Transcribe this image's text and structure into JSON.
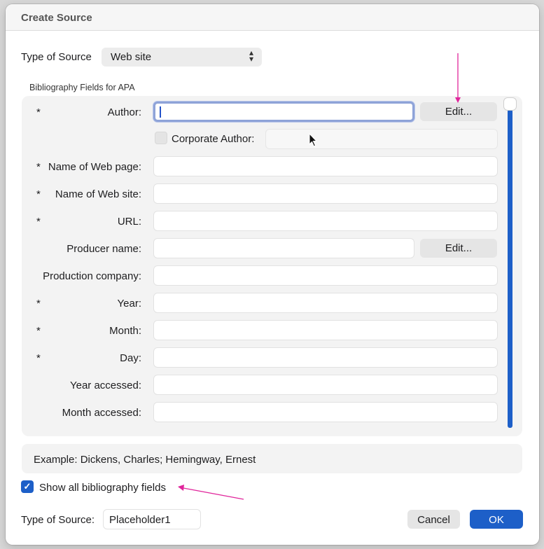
{
  "dialog": {
    "title": "Create Source"
  },
  "type_of_source": {
    "label": "Type of Source",
    "selected": "Web site"
  },
  "section_label": "Bibliography Fields for APA",
  "required_marker": "*",
  "fields": {
    "author": {
      "label": "Author:",
      "value": "",
      "required": true,
      "edit_label": "Edit..."
    },
    "corporate_author": {
      "label": "Corporate Author:",
      "checked": false,
      "value": ""
    },
    "name_of_web_page": {
      "label": "Name of Web page:",
      "value": "",
      "required": true
    },
    "name_of_web_site": {
      "label": "Name of Web site:",
      "value": "",
      "required": true
    },
    "url": {
      "label": "URL:",
      "value": "",
      "required": true
    },
    "producer_name": {
      "label": "Producer name:",
      "value": "",
      "required": false,
      "edit_label": "Edit..."
    },
    "production_company": {
      "label": "Production company:",
      "value": "",
      "required": false
    },
    "year": {
      "label": "Year:",
      "value": "",
      "required": true
    },
    "month": {
      "label": "Month:",
      "value": "",
      "required": true
    },
    "day": {
      "label": "Day:",
      "value": "",
      "required": true
    },
    "year_accessed": {
      "label": "Year accessed:",
      "value": "",
      "required": false
    },
    "month_accessed": {
      "label": "Month accessed:",
      "value": "",
      "required": false
    }
  },
  "example": "Example: Dickens, Charles; Hemingway, Ernest",
  "show_all": {
    "label": "Show all bibliography fields",
    "checked": true
  },
  "tag": {
    "label": "Type of Source:",
    "value": "Placeholder1"
  },
  "buttons": {
    "cancel": "Cancel",
    "ok": "OK"
  },
  "colors": {
    "accent": "#1d5fc8",
    "annotation_arrow": "#e0259b",
    "focus_ring": "#8ea3d8"
  },
  "icons": {
    "select_chevron": "chevron-up-down-icon",
    "checkbox": "checkmark-icon",
    "pointer": "mouse-pointer-icon"
  }
}
